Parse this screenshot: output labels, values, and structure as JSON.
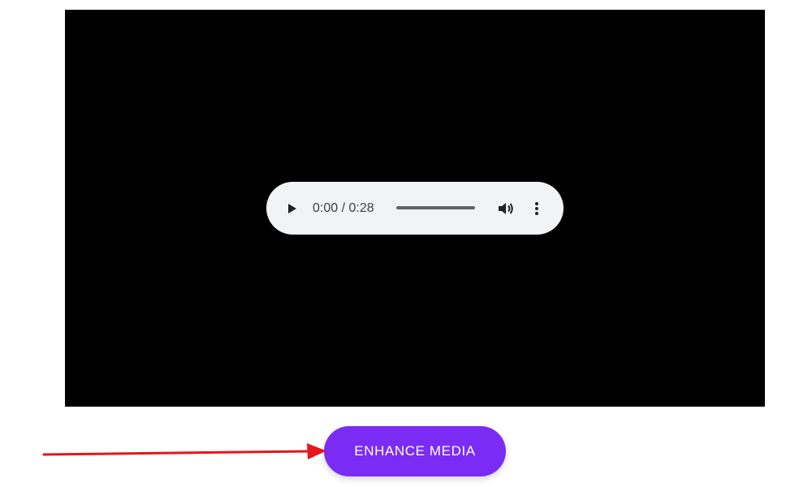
{
  "media": {
    "stage_color": "#000000",
    "player": {
      "time_display": "0:00 / 0:28",
      "current_time": "0:00",
      "duration": "0:28",
      "progress_fraction": 0.0,
      "play_icon": "play-icon",
      "volume_icon": "volume-icon",
      "more_icon": "more-options-icon"
    }
  },
  "actions": {
    "enhance_label": "ENHANCE MEDIA",
    "enhance_color": "#7a2cf5"
  },
  "annotation": {
    "arrow_color": "#e8141b"
  }
}
